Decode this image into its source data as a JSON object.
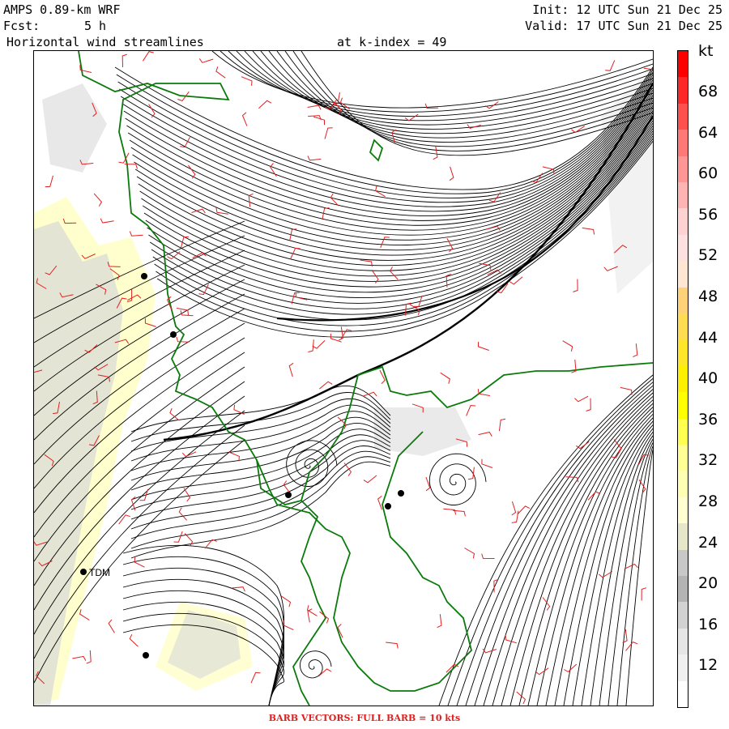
{
  "header": {
    "model": "AMPS 0.89-km WRF",
    "fcst_label": "Fcst:",
    "fcst_value": "5 h",
    "init": "Init: 12 UTC Sun 21 Dec 25",
    "valid": "Valid: 17 UTC Sun 21 Dec 25",
    "field": "Horizontal wind streamlines",
    "level": "at k-index = 49"
  },
  "colorbar": {
    "unit": "kt",
    "labels": [
      "68",
      "64",
      "60",
      "56",
      "52",
      "48",
      "44",
      "40",
      "36",
      "32",
      "28",
      "24",
      "20",
      "16",
      "12"
    ],
    "colors": [
      "#ff0000",
      "#ff2828",
      "#ff5050",
      "#ff7878",
      "#ff9696",
      "#ffb4b4",
      "#ffd2d2",
      "#ffe0e0",
      "#ffe6d2",
      "#ffd278",
      "#ffdc50",
      "#ffe628",
      "#fff000",
      "#ffff00",
      "#ffff50",
      "#ffff96",
      "#ffffb4",
      "#ffffd2",
      "#e6e6c8",
      "#c8c8c8",
      "#b4b4b4",
      "#d2d2d2",
      "#e6e6e6",
      "#f0f0f0",
      "#ffffff"
    ]
  },
  "stations": [
    {
      "label": "TDM"
    }
  ],
  "colors": {
    "streamline": "#000000",
    "coastline": "#0a7a0a",
    "barb": "#e02020",
    "terrain_gray": "#cfcfcf",
    "terrain_yellow": "#ffffc0"
  },
  "footer": "BARB VECTORS:  FULL BARB = 10 kts"
}
